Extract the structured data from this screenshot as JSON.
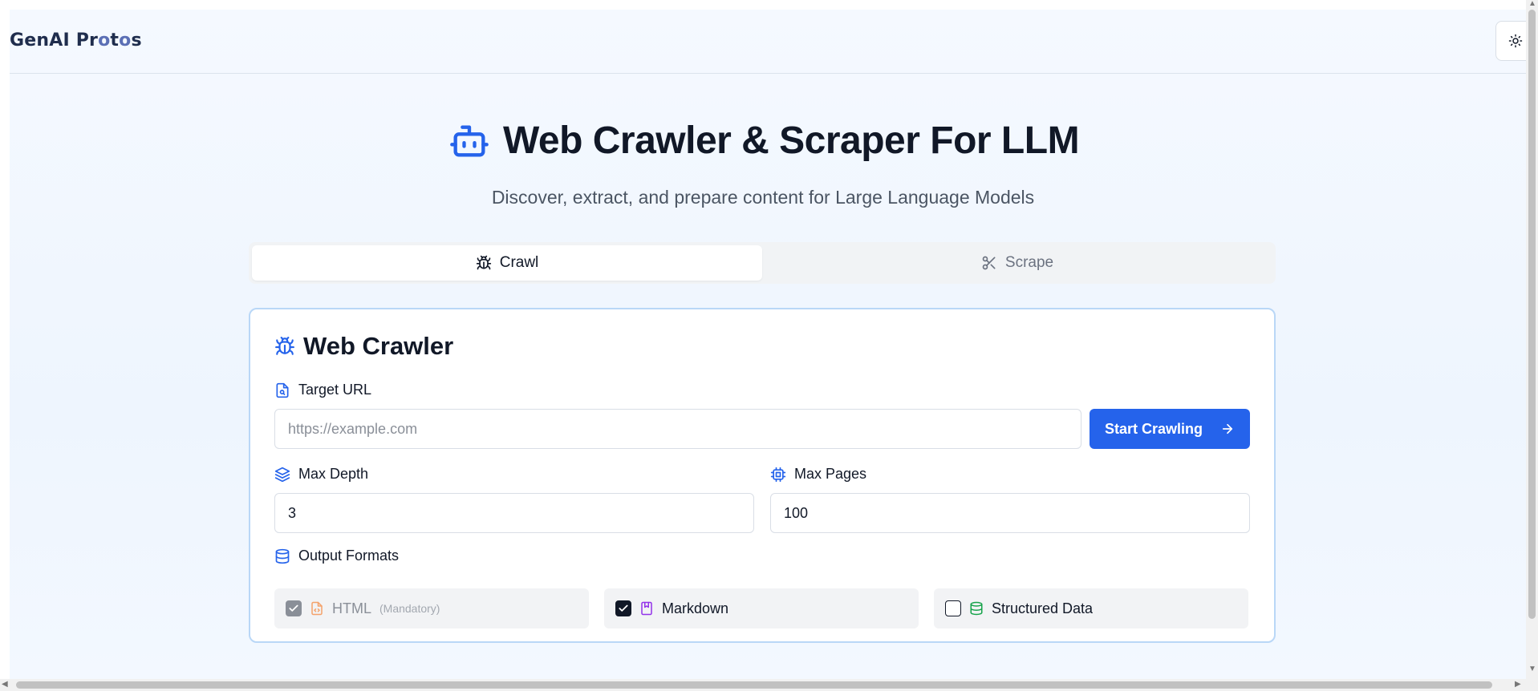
{
  "brand": {
    "name_part1": "GenAI Pr",
    "name_o1": "o",
    "name_part2": "t",
    "name_o2": "o",
    "name_part3": "s"
  },
  "hero": {
    "title": "Web Crawler & Scraper For LLM",
    "subtitle": "Discover, extract, and prepare content for Large Language Models"
  },
  "tabs": [
    {
      "label": "Crawl",
      "icon": "bug-icon",
      "active": true
    },
    {
      "label": "Scrape",
      "icon": "scissors-icon",
      "active": false
    }
  ],
  "crawler": {
    "title": "Web Crawler",
    "target_url_label": "Target URL",
    "target_url_placeholder": "https://example.com",
    "start_button": "Start Crawling",
    "max_depth_label": "Max Depth",
    "max_depth_value": "3",
    "max_pages_label": "Max Pages",
    "max_pages_value": "100",
    "output_formats_label": "Output Formats",
    "formats": [
      {
        "label": "HTML",
        "note": "(Mandatory)",
        "checked": true,
        "disabled": true,
        "icon": "file-code-icon",
        "color": "#f97316"
      },
      {
        "label": "Markdown",
        "note": "",
        "checked": true,
        "disabled": false,
        "icon": "bookmark-file-icon",
        "color": "#9333ea"
      },
      {
        "label": "Structured Data",
        "note": "",
        "checked": false,
        "disabled": false,
        "icon": "database-icon",
        "color": "#16a34a"
      }
    ]
  },
  "colors": {
    "accent": "#2563eb",
    "card_border": "#b9d7f7"
  }
}
